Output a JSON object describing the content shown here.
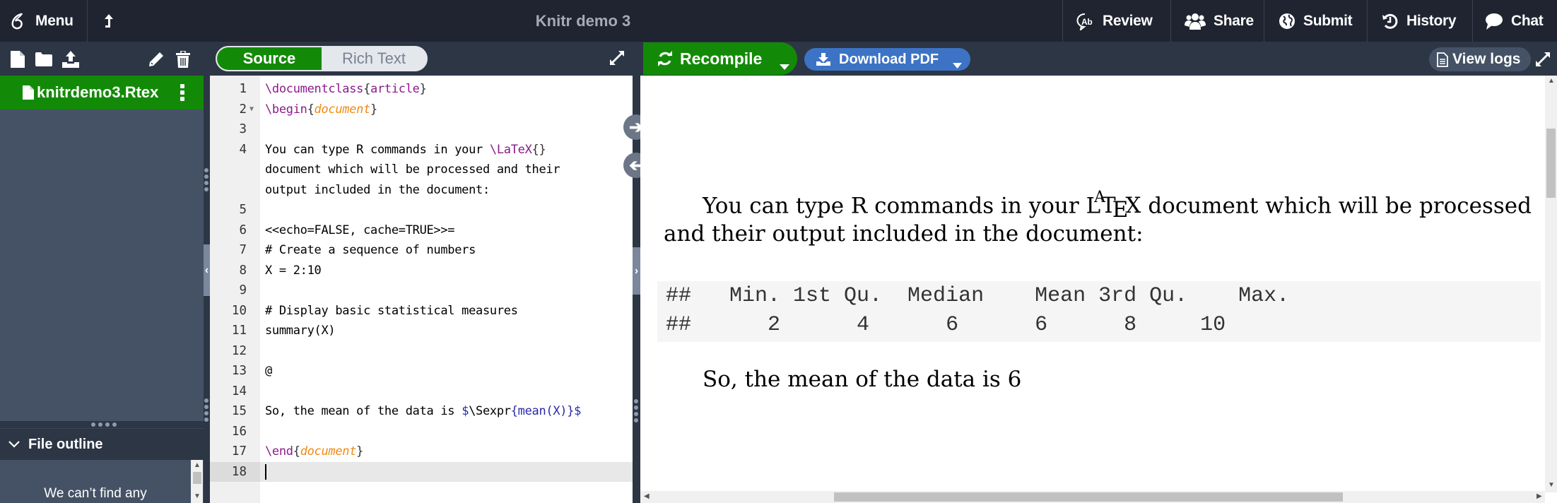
{
  "topbar": {
    "menu_label": "Menu",
    "title": "Knitr demo 3",
    "actions": [
      {
        "label": "Review",
        "icon": "review-icon"
      },
      {
        "label": "Share",
        "icon": "users-icon"
      },
      {
        "label": "Submit",
        "icon": "globe-icon"
      },
      {
        "label": "History",
        "icon": "history-icon"
      },
      {
        "label": "Chat",
        "icon": "chat-bubble-icon"
      }
    ]
  },
  "file_toolbar": {
    "icons": [
      "new-file-icon",
      "new-folder-icon",
      "upload-icon",
      "rename-pencil-icon",
      "delete-trash-icon"
    ]
  },
  "file_tree": {
    "selected_file": "knitrdemo3.Rtex"
  },
  "file_outline": {
    "header": "File outline",
    "body_text": "We can’t find any"
  },
  "editor": {
    "mode_source": "Source",
    "mode_rich": "Rich Text",
    "lines": [
      {
        "n": "1",
        "segments": [
          {
            "t": "\\documentclass",
            "c": "kw"
          },
          {
            "t": "{",
            "c": "br"
          },
          {
            "t": "article",
            "c": "kw"
          },
          {
            "t": "}",
            "c": "br"
          }
        ]
      },
      {
        "n": "2",
        "fold": true,
        "segments": [
          {
            "t": "\\begin",
            "c": "kw"
          },
          {
            "t": "{",
            "c": "br"
          },
          {
            "t": "document",
            "c": "env"
          },
          {
            "t": "}",
            "c": "br"
          }
        ]
      },
      {
        "n": "3",
        "segments": []
      },
      {
        "n": "4",
        "segments": [
          {
            "t": "You can type R commands in your ",
            "c": ""
          },
          {
            "t": "\\LaTeX",
            "c": "kw"
          },
          {
            "t": "{}",
            "c": "br"
          }
        ]
      },
      {
        "n": "",
        "segments": [
          {
            "t": "document which will be processed and their",
            "c": ""
          }
        ]
      },
      {
        "n": "",
        "segments": [
          {
            "t": "output included in the document:",
            "c": ""
          }
        ]
      },
      {
        "n": "5",
        "segments": []
      },
      {
        "n": "6",
        "segments": [
          {
            "t": "<<echo=FALSE, cache=TRUE>>=",
            "c": ""
          }
        ]
      },
      {
        "n": "7",
        "segments": [
          {
            "t": "# Create a sequence of numbers",
            "c": ""
          }
        ]
      },
      {
        "n": "8",
        "segments": [
          {
            "t": "X = 2:10",
            "c": ""
          }
        ]
      },
      {
        "n": "9",
        "segments": []
      },
      {
        "n": "10",
        "segments": [
          {
            "t": "# Display basic statistical measures",
            "c": ""
          }
        ]
      },
      {
        "n": "11",
        "segments": [
          {
            "t": "summary(X)",
            "c": ""
          }
        ]
      },
      {
        "n": "12",
        "segments": []
      },
      {
        "n": "13",
        "segments": [
          {
            "t": "@",
            "c": ""
          }
        ]
      },
      {
        "n": "14",
        "segments": []
      },
      {
        "n": "15",
        "segments": [
          {
            "t": "So, the mean of the data is ",
            "c": ""
          },
          {
            "t": "$",
            "c": "sexpr"
          },
          {
            "t": "\\Sexpr",
            "c": ""
          },
          {
            "t": "{mean(X)}$",
            "c": "sexpr"
          }
        ]
      },
      {
        "n": "16",
        "segments": []
      },
      {
        "n": "17",
        "segments": [
          {
            "t": "\\end",
            "c": "kw"
          },
          {
            "t": "{",
            "c": "br"
          },
          {
            "t": "document",
            "c": "env"
          },
          {
            "t": "}",
            "c": "br"
          }
        ]
      },
      {
        "n": "18",
        "active": true,
        "segments": []
      }
    ]
  },
  "pdf_toolbar": {
    "recompile_label": "Recompile",
    "download_label": "Download PDF",
    "view_logs_label": "View logs"
  },
  "pdf": {
    "para1_line1": "You can type R commands in your",
    "latex_logo": "LaTeX",
    "para1_line1_end": "document which will be processed",
    "para1_line2": "and their output included in the document:",
    "output_header": [
      "##",
      "Min.",
      "1st Qu.",
      "Median",
      "Mean",
      "3rd Qu.",
      "Max."
    ],
    "output_values": [
      "##",
      "2",
      "4",
      "6",
      "6",
      "8",
      "10"
    ],
    "para2": "So, the mean of the data is 6"
  }
}
